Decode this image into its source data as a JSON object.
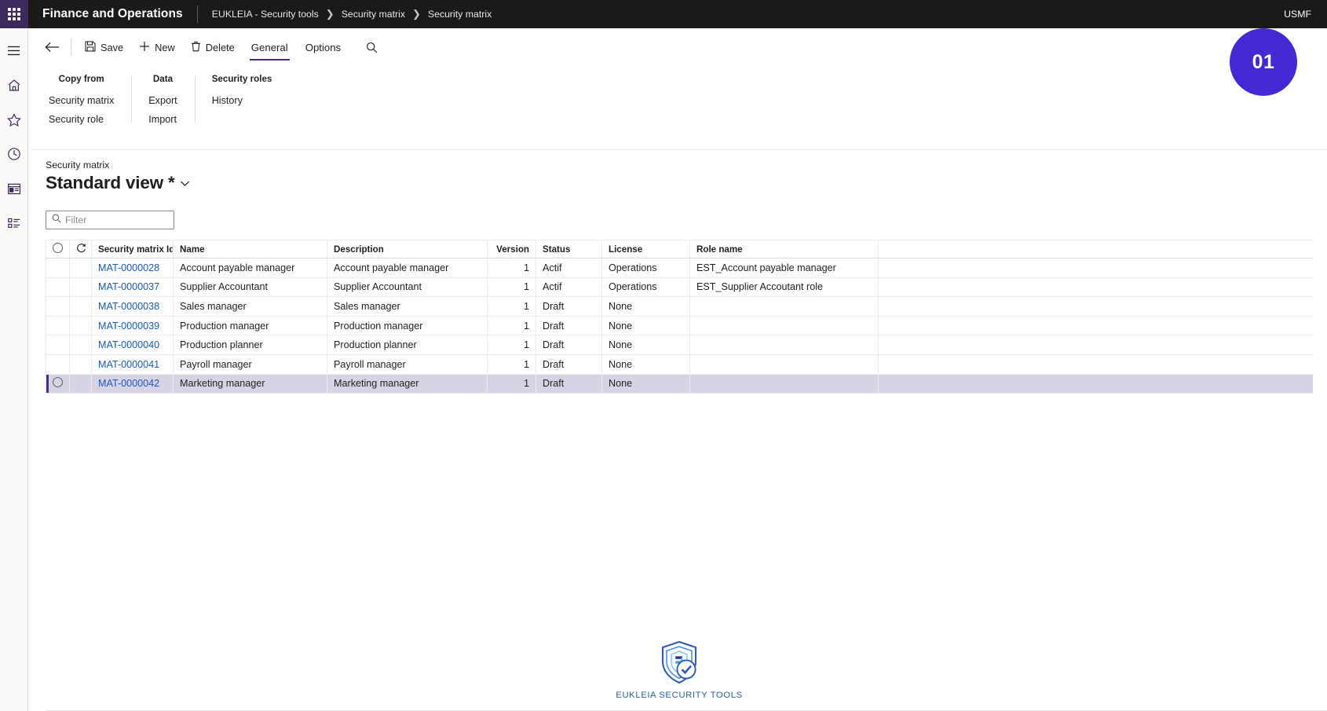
{
  "topbar": {
    "waffle_icon": "app-launcher-icon",
    "brand": "Finance and Operations",
    "breadcrumb": [
      "EUKLEIA - Security tools",
      "Security matrix",
      "Security matrix"
    ],
    "separator": "›",
    "company": "USMF"
  },
  "rail": {
    "items": [
      {
        "icon": "hamburger-menu-icon",
        "name": "navigation-menu"
      },
      {
        "icon": "home-icon",
        "name": "home"
      },
      {
        "icon": "star-icon",
        "name": "favorites"
      },
      {
        "icon": "clock-icon",
        "name": "recent"
      },
      {
        "icon": "workspace-icon",
        "name": "workspaces"
      },
      {
        "icon": "list-icon",
        "name": "modules"
      }
    ]
  },
  "actionpane": {
    "back_icon": "back-arrow-icon",
    "commands": [
      {
        "label": "Save",
        "icon": "save-icon"
      },
      {
        "label": "New",
        "icon": "plus-icon"
      },
      {
        "label": "Delete",
        "icon": "trash-icon"
      }
    ],
    "tabs": [
      {
        "label": "General",
        "active": true
      },
      {
        "label": "Options",
        "active": false
      }
    ],
    "search_icon": "search-icon",
    "groups": [
      {
        "title": "Copy from",
        "links": [
          "Security matrix",
          "Security role"
        ]
      },
      {
        "title": "Data",
        "links": [
          "Export",
          "Import"
        ]
      },
      {
        "title": "Security roles",
        "links": [
          "History"
        ]
      }
    ],
    "badge": "01",
    "badge_color": "#4527d4"
  },
  "page": {
    "caption": "Security matrix",
    "view_title": "Standard view *",
    "view_chevron": "chevron-down-icon"
  },
  "filter": {
    "icon": "search-icon",
    "placeholder": "Filter",
    "value": ""
  },
  "grid": {
    "select_all_icon": "select-all-circle-icon",
    "refresh_icon": "refresh-icon",
    "sort_filter_icon": "filter-sort-icon",
    "columns": [
      {
        "label": "Security matrix Id",
        "align": "left"
      },
      {
        "label": "Name",
        "align": "left"
      },
      {
        "label": "Description",
        "align": "left"
      },
      {
        "label": "Version",
        "align": "right"
      },
      {
        "label": "Status",
        "align": "left"
      },
      {
        "label": "License",
        "align": "left"
      },
      {
        "label": "Role name",
        "align": "left"
      }
    ],
    "rows": [
      {
        "id": "MAT-0000028",
        "name": "Account payable manager",
        "description": "Account payable manager",
        "version": "1",
        "status": "Actif",
        "license": "Operations",
        "role_name": "EST_Account payable manager",
        "selected": false
      },
      {
        "id": "MAT-0000037",
        "name": "Supplier Accountant",
        "description": "Supplier Accountant",
        "version": "1",
        "status": "Actif",
        "license": "Operations",
        "role_name": "EST_Supplier Accoutant role",
        "selected": false
      },
      {
        "id": "MAT-0000038",
        "name": "Sales manager",
        "description": "Sales manager",
        "version": "1",
        "status": "Draft",
        "license": "None",
        "role_name": "",
        "selected": false
      },
      {
        "id": "MAT-0000039",
        "name": "Production manager",
        "description": "Production manager",
        "version": "1",
        "status": "Draft",
        "license": "None",
        "role_name": "",
        "selected": false
      },
      {
        "id": "MAT-0000040",
        "name": "Production planner",
        "description": "Production planner",
        "version": "1",
        "status": "Draft",
        "license": "None",
        "role_name": "",
        "selected": false
      },
      {
        "id": "MAT-0000041",
        "name": "Payroll manager",
        "description": "Payroll manager",
        "version": "1",
        "status": "Draft",
        "license": "None",
        "role_name": "",
        "selected": false
      },
      {
        "id": "MAT-0000042",
        "name": "Marketing manager",
        "description": "Marketing manager",
        "version": "1",
        "status": "Draft",
        "license": "None",
        "role_name": "",
        "selected": true
      }
    ]
  },
  "footer": {
    "logo_icon": "eukleia-shield-logo",
    "logo_text": "EUKLEIA SECURITY TOOLS"
  }
}
